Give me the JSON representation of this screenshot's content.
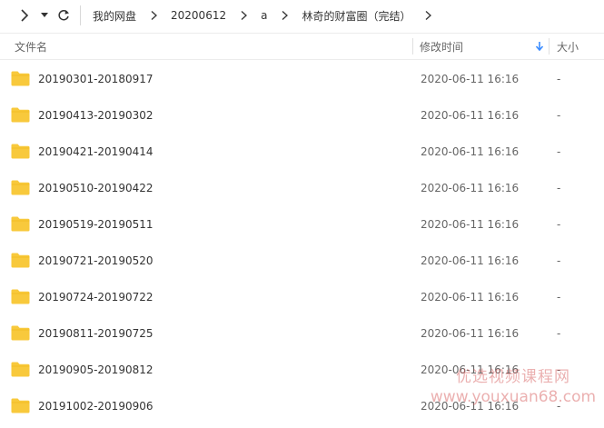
{
  "breadcrumb": {
    "items": [
      "我的网盘",
      "20200612",
      "a",
      "林奇的财富圈（完结）"
    ]
  },
  "columns": {
    "name": "文件名",
    "modified": "修改时间",
    "size": "大小"
  },
  "colors": {
    "folder": "#F8C93C",
    "sort_arrow": "#3B8CFF"
  },
  "files": [
    {
      "name": "20190301-20180917",
      "modified": "2020-06-11 16:16",
      "size": "-",
      "icon": "folder-icon"
    },
    {
      "name": "20190413-20190302",
      "modified": "2020-06-11 16:16",
      "size": "-",
      "icon": "folder-icon"
    },
    {
      "name": "20190421-20190414",
      "modified": "2020-06-11 16:16",
      "size": "-",
      "icon": "folder-icon"
    },
    {
      "name": "20190510-20190422",
      "modified": "2020-06-11 16:16",
      "size": "-",
      "icon": "folder-icon"
    },
    {
      "name": "20190519-20190511",
      "modified": "2020-06-11 16:16",
      "size": "-",
      "icon": "folder-icon"
    },
    {
      "name": "20190721-20190520",
      "modified": "2020-06-11 16:16",
      "size": "-",
      "icon": "folder-icon"
    },
    {
      "name": "20190724-20190722",
      "modified": "2020-06-11 16:16",
      "size": "-",
      "icon": "folder-icon"
    },
    {
      "name": "20190811-20190725",
      "modified": "2020-06-11 16:16",
      "size": "-",
      "icon": "folder-icon"
    },
    {
      "name": "20190905-20190812",
      "modified": "2020-06-11 16:16",
      "size": "-",
      "icon": "folder-icon"
    },
    {
      "name": "20191002-20190906",
      "modified": "2020-06-11 16:16",
      "size": "-",
      "icon": "folder-icon"
    }
  ],
  "watermark": {
    "line1": "优选视频课程网",
    "line2": "www.youxuan68.com"
  }
}
